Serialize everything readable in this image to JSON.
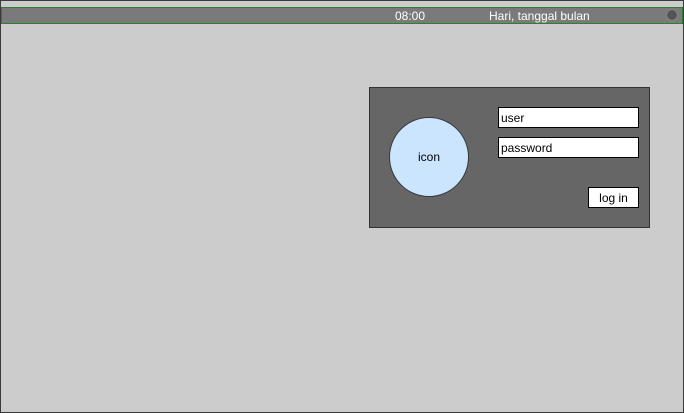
{
  "status_bar": {
    "time": "08:00",
    "date": "Hari, tanggal bulan",
    "power_icon": "power-dot-icon"
  },
  "login": {
    "avatar_label": "icon",
    "user_placeholder": "user",
    "password_placeholder": "password",
    "login_label": "log in"
  },
  "colors": {
    "background": "#cccccc",
    "topbar": "#7a7a7a",
    "panel": "#666666",
    "avatar": "#cce5ff"
  }
}
